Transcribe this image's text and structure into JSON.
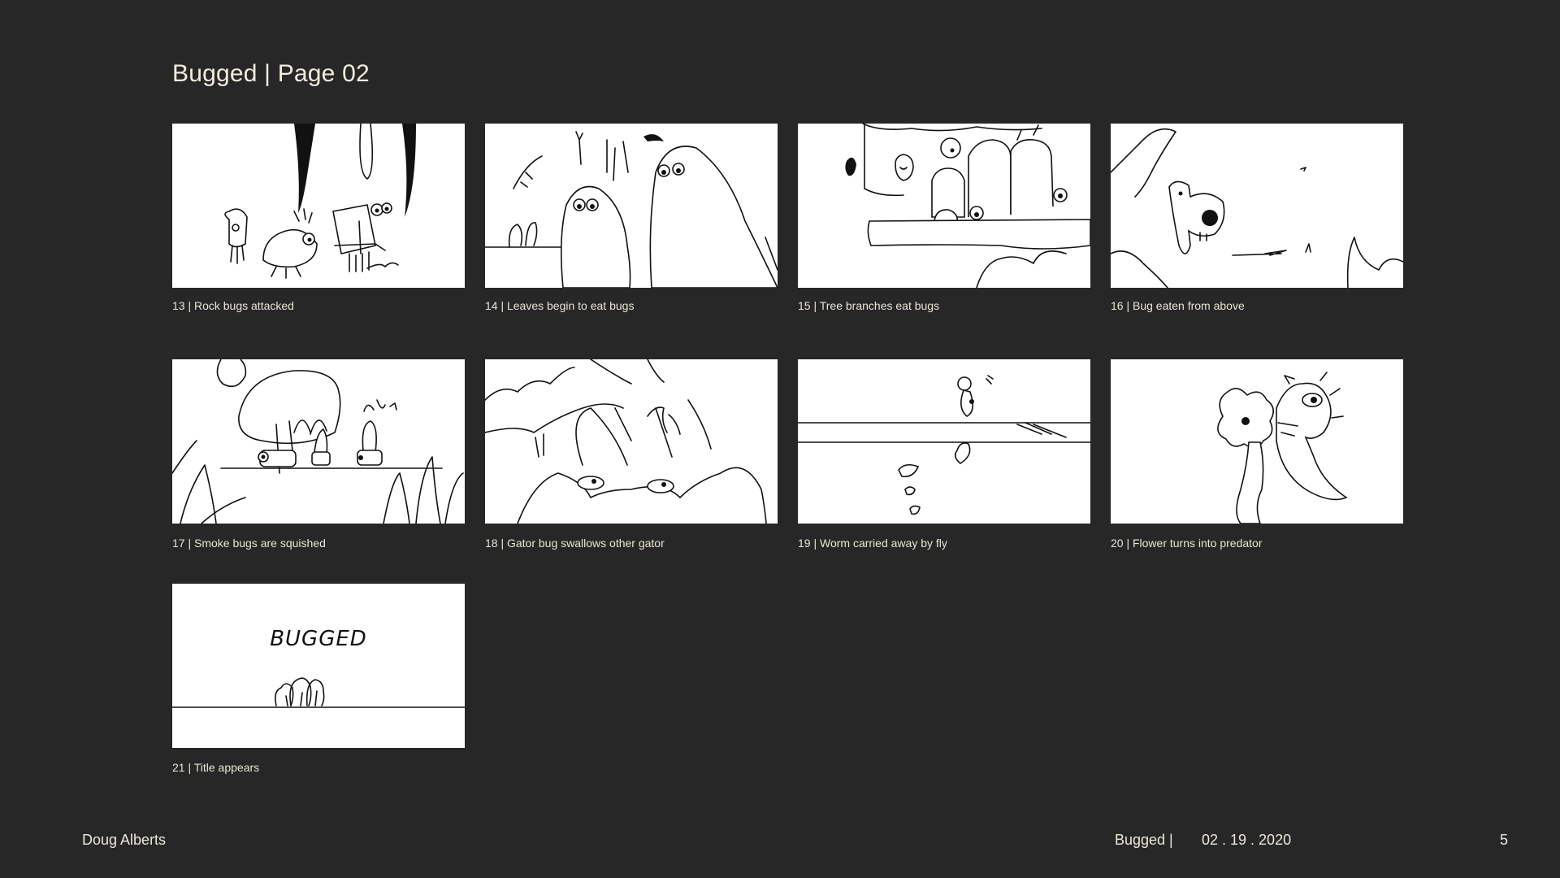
{
  "page": {
    "title": "Bugged | Page 02"
  },
  "panels": [
    {
      "caption": "13 | Rock bugs attacked"
    },
    {
      "caption": "14 | Leaves begin to eat bugs"
    },
    {
      "caption": "15 | Tree branches eat bugs"
    },
    {
      "caption": "16 | Bug eaten from above"
    },
    {
      "caption": "17 | Smoke bugs are squished"
    },
    {
      "caption": "18 | Gator bug swallows other gator"
    },
    {
      "caption": "19 | Worm carried away by fly"
    },
    {
      "caption": "20 | Flower turns into predator"
    },
    {
      "caption": "21 | Title appears",
      "sketch_text": "BUGGED"
    }
  ],
  "footer": {
    "author": "Doug Alberts",
    "project": "Bugged |",
    "date": "02 . 19 . 2020",
    "page_number": "5"
  }
}
